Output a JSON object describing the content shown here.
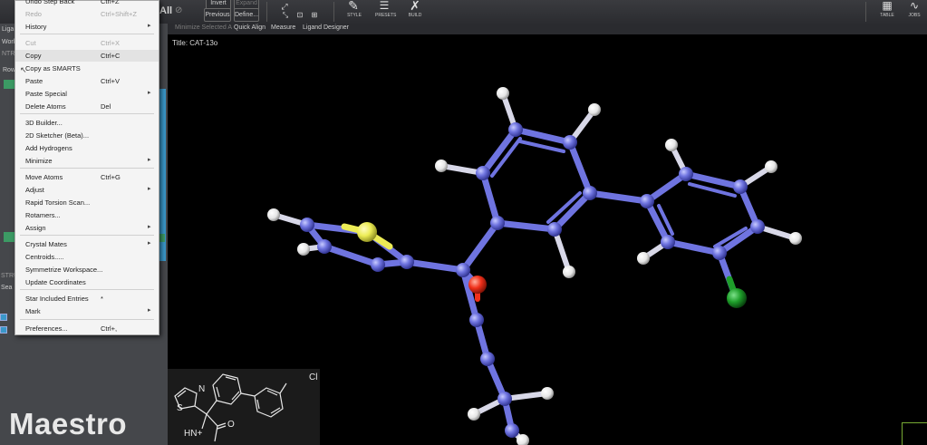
{
  "toolbar": {
    "all_label": "All",
    "invert": "Invert",
    "expand": "Expand",
    "previous": "Previous",
    "define": "Define...",
    "style": "STYLE",
    "presets": "PRESETS",
    "build": "BUILD",
    "table": "TABLE",
    "jobs": "JOBS"
  },
  "subbar": {
    "minimize": "Minimize Selected A",
    "quick_align": "Quick Align",
    "measure": "Measure",
    "ligand_designer": "Ligand Designer"
  },
  "left_panel": {
    "ligand": "Liga",
    "work": "Work",
    "ntr": "NTR",
    "rows": "Row",
    "stru": "STRU",
    "search": "Sea"
  },
  "viewer": {
    "title": "Title: CAT-13o",
    "logo": "Maestro"
  },
  "menu": {
    "items": [
      {
        "label": "Undo Step Back",
        "shortcut": "Ctrl+Z",
        "disabled": false
      },
      {
        "label": "Redo",
        "shortcut": "Ctrl+Shift+Z",
        "disabled": true
      },
      {
        "label": "History",
        "shortcut": "",
        "submenu": true
      },
      {
        "label": "Cut",
        "shortcut": "Ctrl+X",
        "disabled": true
      },
      {
        "label": "Copy",
        "shortcut": "Ctrl+C",
        "highlighted": true
      },
      {
        "label": "Copy as SMARTS",
        "shortcut": ""
      },
      {
        "label": "Paste",
        "shortcut": "Ctrl+V"
      },
      {
        "label": "Paste Special",
        "shortcut": "",
        "submenu": true
      },
      {
        "label": "Delete Atoms",
        "shortcut": "Del"
      },
      {
        "label": "3D Builder...",
        "shortcut": ""
      },
      {
        "label": "2D Sketcher (Beta)...",
        "shortcut": ""
      },
      {
        "label": "Add Hydrogens",
        "shortcut": ""
      },
      {
        "label": "Minimize",
        "shortcut": "",
        "submenu": true
      },
      {
        "label": "Move Atoms",
        "shortcut": "Ctrl+G"
      },
      {
        "label": "Adjust",
        "shortcut": "",
        "submenu": true
      },
      {
        "label": "Rapid Torsion Scan...",
        "shortcut": ""
      },
      {
        "label": "Rotamers...",
        "shortcut": ""
      },
      {
        "label": "Assign",
        "shortcut": "",
        "submenu": true
      },
      {
        "label": "Crystal Mates",
        "shortcut": "",
        "submenu": true
      },
      {
        "label": "Centroids.....",
        "shortcut": ""
      },
      {
        "label": "Symmetrize Workspace...",
        "shortcut": ""
      },
      {
        "label": "Update Coordinates",
        "shortcut": ""
      },
      {
        "label": "Star Included Entries",
        "shortcut": "*"
      },
      {
        "label": "Mark",
        "shortcut": "",
        "submenu": true
      },
      {
        "label": "Preferences...",
        "shortcut": "Ctrl+,"
      }
    ]
  },
  "sketch": {
    "s_label": "S",
    "n_label": "N",
    "cl_label": "Cl",
    "nh_label": "HN+",
    "o_label": "O"
  },
  "colors": {
    "carbon": "#6f74e0",
    "hydrogen": "#ffffff",
    "sulfur": "#ecec55",
    "oxygen": "#f0301a",
    "chlorine": "#1e9e2a",
    "background": "#000000"
  }
}
